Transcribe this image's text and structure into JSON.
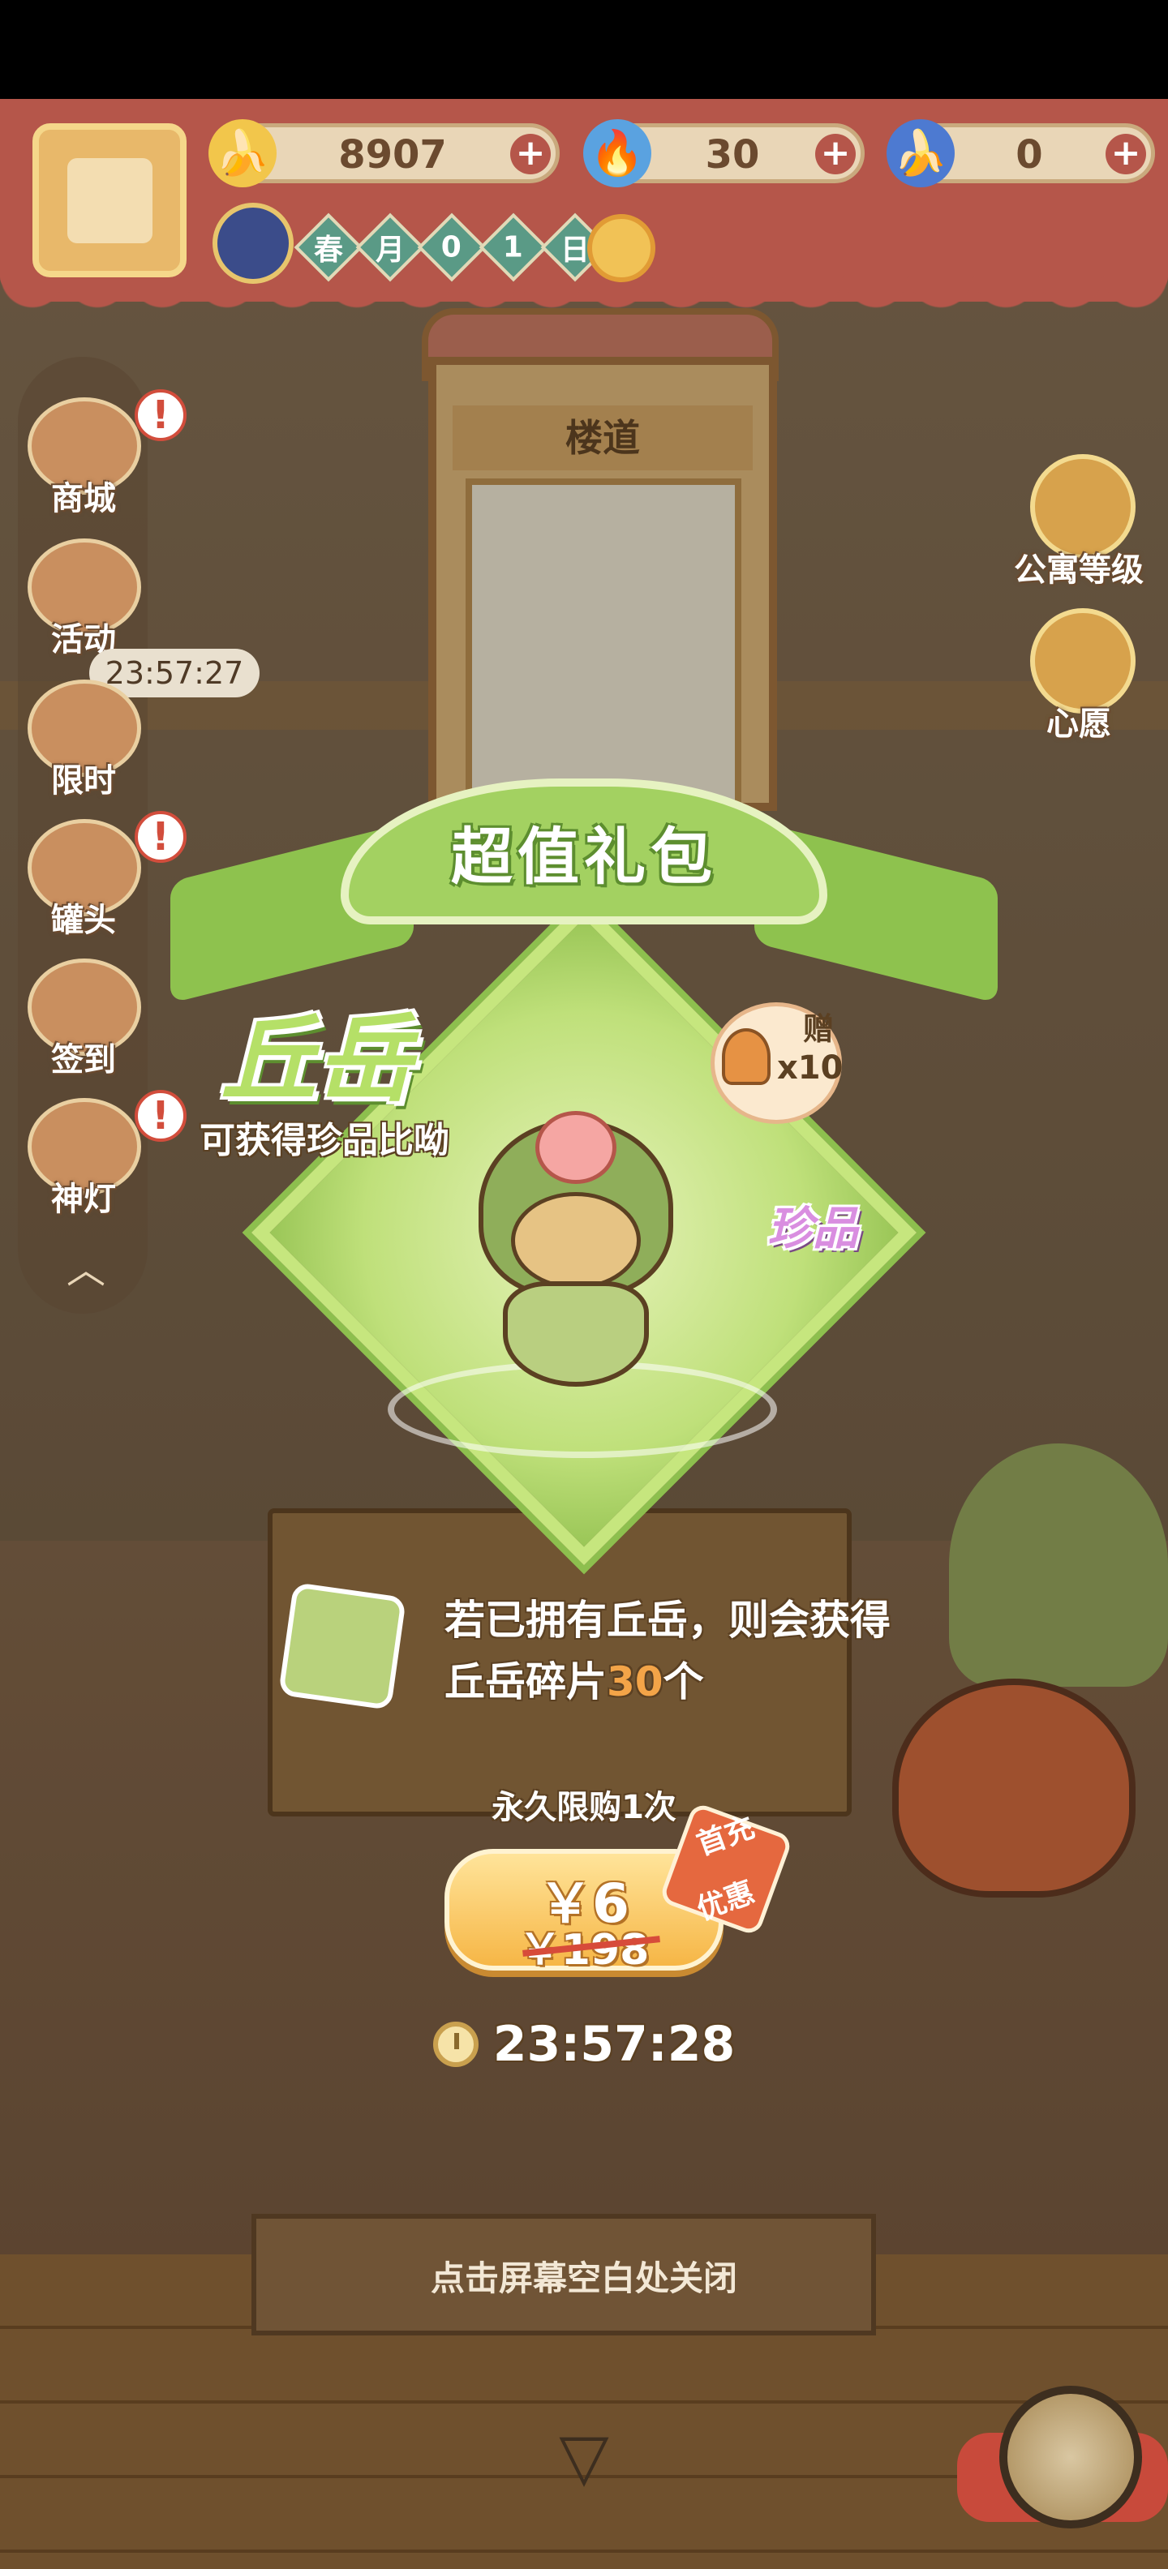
{
  "hud": {
    "currencies": [
      {
        "icon": "banana-icon",
        "value": "8907"
      },
      {
        "icon": "blue-flame-icon",
        "value": "30"
      },
      {
        "icon": "blue-banana-icon",
        "value": "0"
      }
    ],
    "date_chars": [
      "春",
      "月",
      "0",
      "1",
      "日"
    ]
  },
  "side_menu": {
    "items": [
      {
        "label": "商城",
        "alert": "!"
      },
      {
        "label": "活动",
        "alert": ""
      },
      {
        "label": "限时",
        "alert": ""
      },
      {
        "label": "罐头",
        "alert": "!"
      },
      {
        "label": "签到",
        "alert": ""
      },
      {
        "label": "神灯",
        "alert": "!"
      }
    ],
    "timer": "23:57:27"
  },
  "right_menu": {
    "apartment_level": "公寓等级",
    "wish": "心愿"
  },
  "scene": {
    "hall_sign": "楼道"
  },
  "popup": {
    "banner": "超值礼包",
    "character_name": "丘岳",
    "subtitle": "可获得珍品比呦",
    "gift_label": "赠",
    "gift_qty": "x10",
    "rarity": "珍品",
    "shard_line1": "若已拥有丘岳，则会获得",
    "shard_line2_prefix": "丘岳碎片",
    "shard_count": "30",
    "shard_line2_suffix": "个",
    "limit": "永久限购1次",
    "price_now": "￥6",
    "price_old": "￥198",
    "first_badge_line1": "首充",
    "first_badge_line2": "优惠",
    "countdown": "23:57:28",
    "close_hint": "点击屏幕空白处关闭"
  },
  "icons": {
    "down_arrow": "▽",
    "collapse": "︿"
  }
}
